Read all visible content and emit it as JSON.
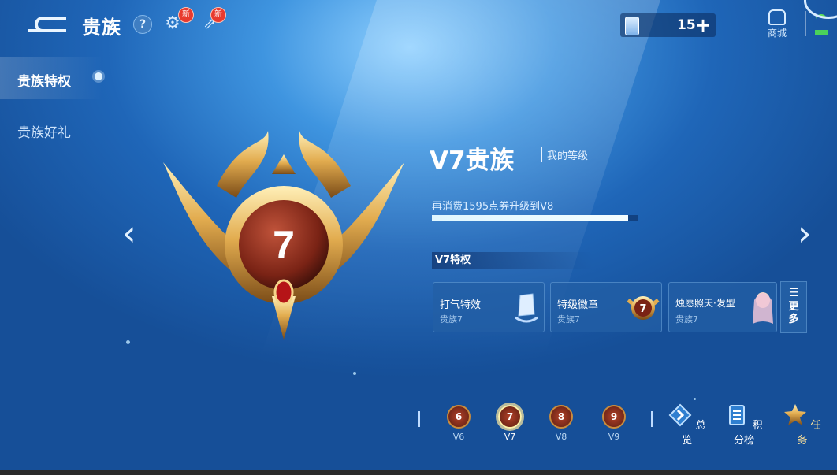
{
  "header": {
    "title": "贵族",
    "help_icon": "question-icon",
    "settings_new": "新",
    "share_new": "新",
    "coupon_count": "15",
    "shop_label": "商城"
  },
  "nav": {
    "items": [
      {
        "label": "贵族特权",
        "active": true
      },
      {
        "label": "贵族好礼",
        "active": false
      }
    ]
  },
  "level": {
    "title": "V7贵族",
    "my_level": "我的等级",
    "upgrade_text": "再消费1595点券升级到V8",
    "progress": 0.95,
    "badge_number": "7"
  },
  "privileges": {
    "label": "V7特权",
    "cards": [
      {
        "name": "打气特效",
        "sub": "贵族7"
      },
      {
        "name": "特级徽章",
        "sub": "贵族7"
      },
      {
        "name": "烛愿照天·发型",
        "sub": "贵族7"
      }
    ],
    "more_label": "更多"
  },
  "levels": [
    {
      "num": "6",
      "label": "V6"
    },
    {
      "num": "7",
      "label": "V7",
      "active": true
    },
    {
      "num": "8",
      "label": "V8"
    },
    {
      "num": "9",
      "label": "V9"
    }
  ],
  "bottom_buttons": [
    {
      "label": "总览"
    },
    {
      "label": "积分榜"
    },
    {
      "label": "任务"
    }
  ],
  "colors": {
    "accent": "#f3c66a",
    "bg": "#1f66b8"
  }
}
